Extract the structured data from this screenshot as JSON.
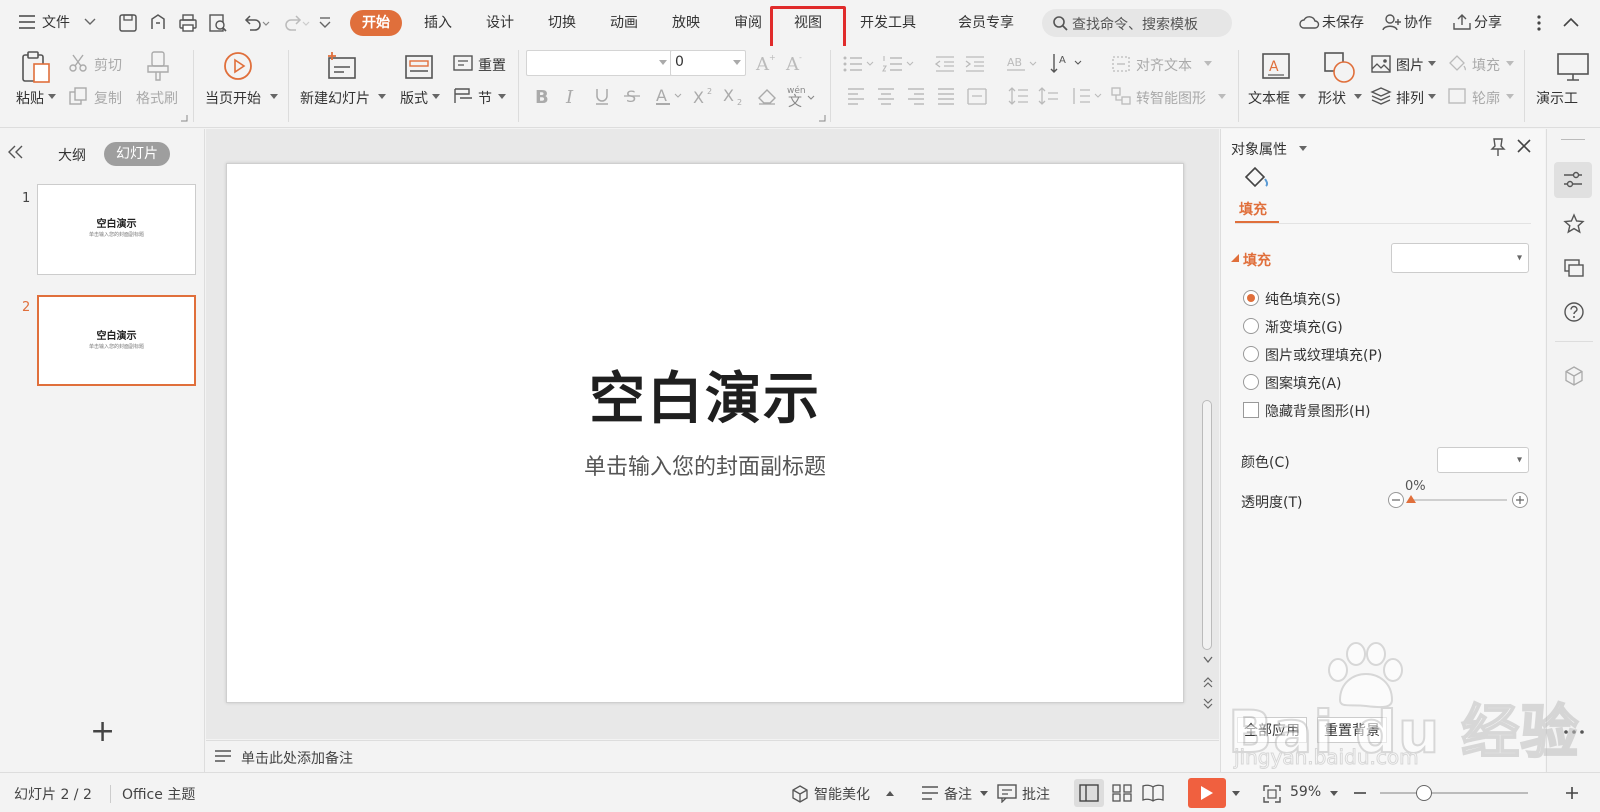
{
  "menu": {
    "file": "文件",
    "tabs": [
      "开始",
      "插入",
      "设计",
      "切换",
      "动画",
      "放映",
      "审阅",
      "视图",
      "开发工具",
      "会员专享"
    ],
    "active_tab": "开始",
    "highlighted_tab": "视图",
    "search_placeholder": "查找命令、搜索模板",
    "unsaved": "未保存",
    "collab": "协作",
    "share": "分享"
  },
  "ribbon": {
    "paste": "粘贴",
    "cut": "剪切",
    "copy": "复制",
    "format_painter": "格式刷",
    "from_current": "当页开始",
    "new_slide": "新建幻灯片",
    "layout": "版式",
    "reset": "重置",
    "section": "节",
    "font_size": "0",
    "align_text": "对齐文本",
    "smart_art": "转智能图形",
    "textbox": "文本框",
    "shape": "形状",
    "picture": "图片",
    "arrange": "排列",
    "fill": "填充",
    "outline": "轮廓",
    "presentation_tool": "演示工"
  },
  "left_pane": {
    "outline_tab": "大纲",
    "slides_tab": "幻灯片",
    "slides": [
      {
        "number": "1",
        "title": "空白演示",
        "subtitle": "单击输入您的封面副标题"
      },
      {
        "number": "2",
        "title": "空白演示",
        "subtitle": "单击输入您的封面副标题"
      }
    ],
    "add": "+"
  },
  "slide": {
    "title": "空白演示",
    "subtitle": "单击输入您的封面副标题"
  },
  "notes": {
    "placeholder": "单击此处添加备注"
  },
  "panel": {
    "title": "对象属性",
    "fill_tab": "填充",
    "fill_section": "填充",
    "options": [
      "纯色填充(S)",
      "渐变填充(G)",
      "图片或纹理填充(P)",
      "图案填充(A)"
    ],
    "hide_bg": "隐藏背景图形(H)",
    "color_label": "颜色(C)",
    "transparency_label": "透明度(T)",
    "transparency_value": "0%",
    "apply_all": "全部应用",
    "reset_bg": "重置背景"
  },
  "status": {
    "slide_count": "幻灯片 2 / 2",
    "theme": "Office 主题",
    "beautify": "智能美化",
    "notes": "备注",
    "comments": "批注",
    "zoom": "59%"
  },
  "watermark": {
    "brand": "Bai du 经验",
    "url": "jingyan.baidu.com"
  },
  "colors": {
    "accent": "#e06f3b",
    "highlight_box": "#e02b2b",
    "play_button": "#f0603f"
  }
}
